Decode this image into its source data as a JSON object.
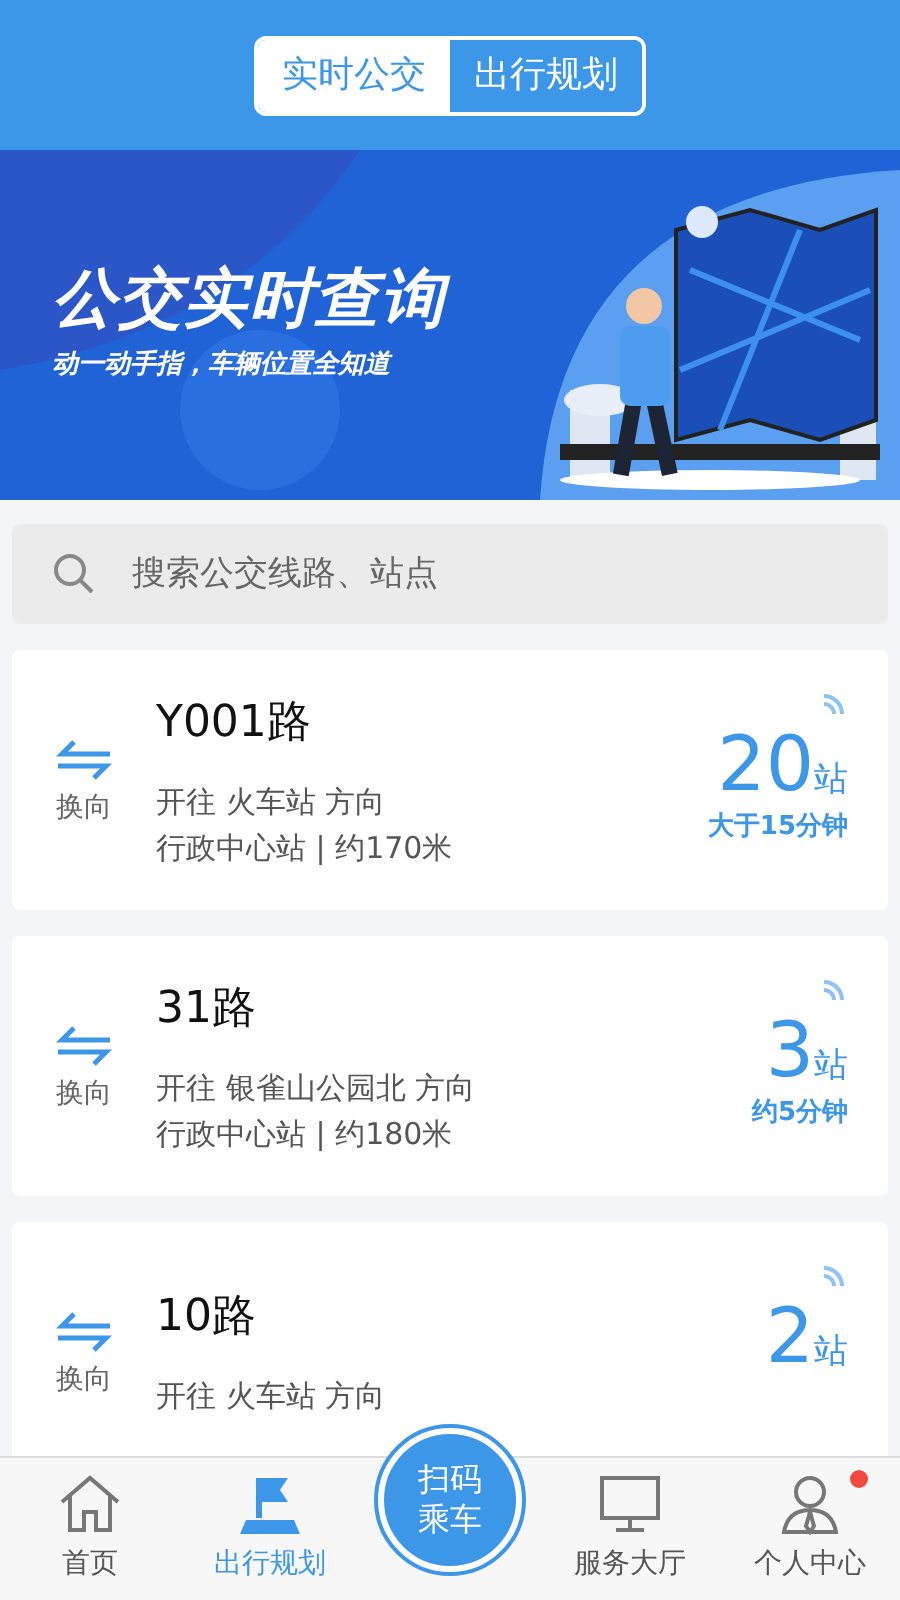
{
  "tabs": [
    {
      "label": "实时公交",
      "selected": true
    },
    {
      "label": "出行规划",
      "selected": false
    }
  ],
  "banner": {
    "title": "公交实时查询",
    "subtitle": "动一动手指，车辆位置全知道"
  },
  "search": {
    "placeholder": "搜索公交线路、站点"
  },
  "routes": [
    {
      "swap": "换向",
      "name": "Y001路",
      "direction": "开往 火车站 方向",
      "station": "行政中心站 | 约170米",
      "stops": "20",
      "unit": "站",
      "eta": "大于15分钟"
    },
    {
      "swap": "换向",
      "name": "31路",
      "direction": "开往 银雀山公园北 方向",
      "station": "行政中心站 | 约180米",
      "stops": "3",
      "unit": "站",
      "eta": "约5分钟"
    },
    {
      "swap": "换向",
      "name": "10路",
      "direction": "开往 火车站 方向",
      "stops": "2",
      "unit": "站"
    }
  ],
  "nav": [
    {
      "kind": "home",
      "label": "首页",
      "selected": false,
      "badge": false
    },
    {
      "kind": "plan",
      "label": "出行规划",
      "selected": true,
      "badge": false
    },
    {
      "kind": "scan",
      "label": "扫码乘车"
    },
    {
      "kind": "service",
      "label": "服务大厅",
      "selected": false,
      "badge": false
    },
    {
      "kind": "profile",
      "label": "个人中心",
      "selected": false,
      "badge": true
    }
  ]
}
